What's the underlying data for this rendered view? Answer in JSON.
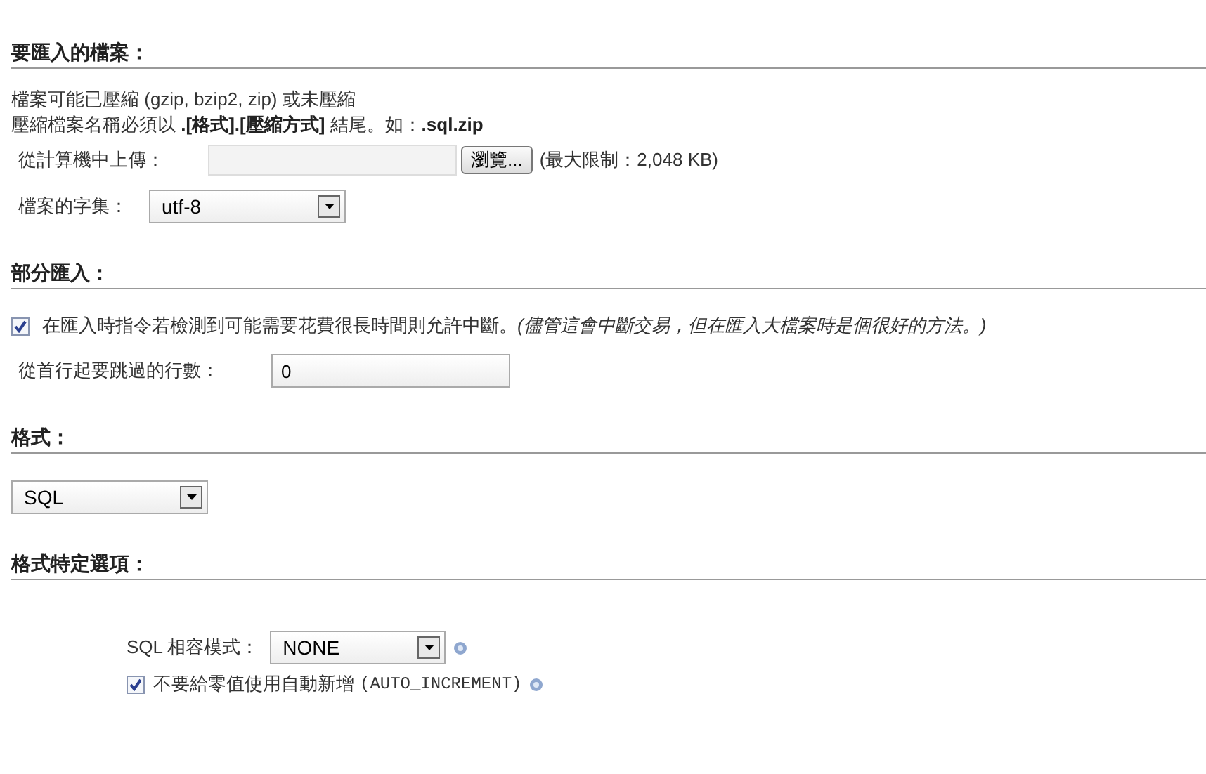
{
  "sections": [
    {
      "heading": "要匯入的檔案：",
      "kind": "file"
    },
    {
      "heading": "部分匯入：",
      "kind": "partial"
    },
    {
      "heading": "格式：",
      "kind": "format"
    },
    {
      "heading": "格式特定選項：",
      "kind": "options"
    }
  ],
  "file": {
    "notes": [
      "檔案可能已壓縮 (gzip, bzip2, zip) 或未壓縮",
      "壓縮檔案名稱必須以 **.[格式].[壓縮方式]** 結尾。如：**.sql.zip**"
    ],
    "upload_label": "從計算機中上傳：",
    "browse_button": "瀏覽...",
    "limit": "(最大限制：2,048 KB)",
    "charset_label": "檔案的字集：",
    "charset_value": "utf-8"
  },
  "partial": {
    "allow_interrupt": {
      "checked": true,
      "label": "在匯入時指令若檢測到可能需要花費很長時間則允許中斷。*(儘管這會中斷交易，但在匯入大檔案時是個很好的方法。)*"
    },
    "skip_label": "從首行起要跳過的行數：",
    "skip_value": "0"
  },
  "format": {
    "value": "SQL"
  },
  "options": {
    "compat_label": "SQL 相容模式：",
    "compat_value": "NONE",
    "no_auto_value": {
      "checked": true,
      "label": "不要給零值使用自動新增",
      "code": "(AUTO_INCREMENT)"
    }
  }
}
